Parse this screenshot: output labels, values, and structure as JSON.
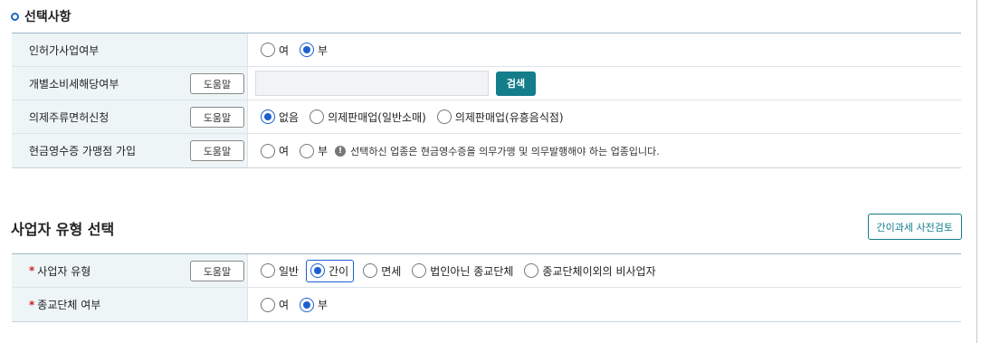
{
  "section1": {
    "title": "선택사항",
    "rows": [
      {
        "label": "인허가사업여부",
        "options": [
          "여",
          "부"
        ]
      },
      {
        "label": "개별소비세해당여부",
        "help": "도움말",
        "search_button": "검색",
        "input_value": ""
      },
      {
        "label": "의제주류면허신청",
        "help": "도움말",
        "options": [
          "없음",
          "의제판매업(일반소매)",
          "의제판매업(유흥음식점)"
        ]
      },
      {
        "label": "현금영수증 가맹점 가입",
        "help": "도움말",
        "options": [
          "여",
          "부"
        ],
        "note": "선택하신 업종은 현금영수증을 의무가맹 및 의무발행해야 하는 업종입니다."
      }
    ]
  },
  "section2": {
    "title": "사업자 유형 선택",
    "pre_check_button": "간이과세 사전검토",
    "required_mark": "*",
    "rows": [
      {
        "label": "사업자 유형",
        "help": "도움말",
        "options": [
          "일반",
          "간이",
          "면세",
          "법인아닌 종교단체",
          "종교단체이외의 비사업자"
        ]
      },
      {
        "label": "종교단체 여부",
        "options": [
          "여",
          "부"
        ]
      }
    ]
  },
  "selected": {
    "license": "부",
    "liquor": "없음",
    "business_type": "간이",
    "religious": "부"
  },
  "colors": {
    "accent": "#1d5fd0",
    "teal": "#147d8a",
    "label_bg": "#eef5f7",
    "required": "#d02020"
  }
}
